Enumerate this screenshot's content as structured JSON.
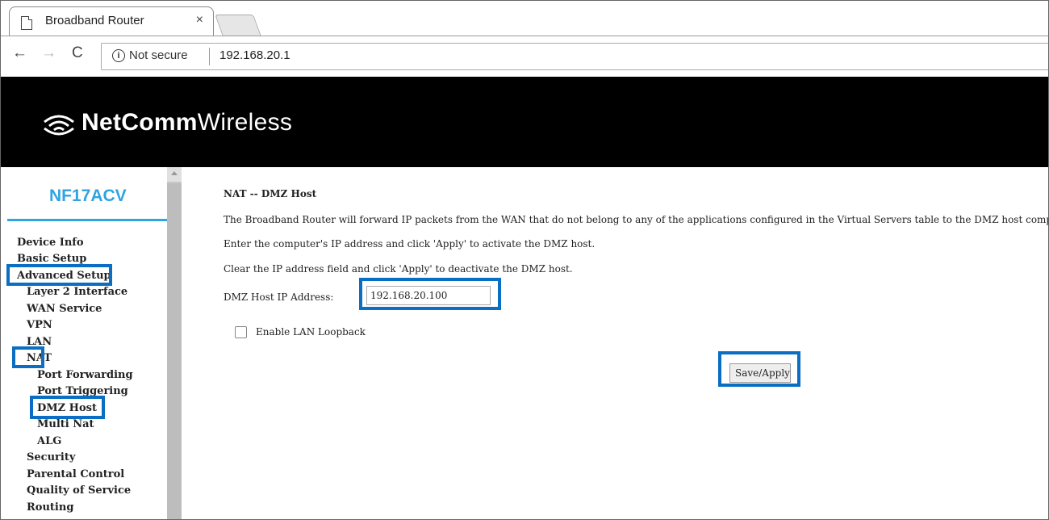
{
  "browser": {
    "tab_title": "Broadband Router",
    "tab_close": "×",
    "security_label": "Not secure",
    "url": "192.168.20.1",
    "info_glyph": "i",
    "back_glyph": "←",
    "forward_glyph": "→",
    "reload_glyph": "C"
  },
  "brand": {
    "logo_bold": "NetComm",
    "logo_light": "Wireless",
    "model": "NF17ACV"
  },
  "sidebar": {
    "items": [
      {
        "label": "Device Info"
      },
      {
        "label": "Basic Setup"
      },
      {
        "label": "Advanced Setup"
      },
      {
        "label": "Layer 2 Interface"
      },
      {
        "label": "WAN Service"
      },
      {
        "label": "VPN"
      },
      {
        "label": "LAN"
      },
      {
        "label": "NAT"
      },
      {
        "label": "Port Forwarding"
      },
      {
        "label": "Port Triggering"
      },
      {
        "label": "DMZ Host"
      },
      {
        "label": "Multi Nat"
      },
      {
        "label": "ALG"
      },
      {
        "label": "Security"
      },
      {
        "label": "Parental Control"
      },
      {
        "label": "Quality of Service"
      },
      {
        "label": "Routing"
      }
    ]
  },
  "main": {
    "title": "NAT -- DMZ Host",
    "para1": "The Broadband Router will forward IP packets from the WAN that do not belong to any of the applications configured in the Virtual Servers table to the DMZ host computer.",
    "para2": "Enter the computer's IP address and click 'Apply' to activate the DMZ host.",
    "para3": "Clear the IP address field and click 'Apply' to deactivate the DMZ host.",
    "ip_label": "DMZ Host IP Address:",
    "ip_value": "192.168.20.100",
    "loopback_label": "Enable LAN Loopback",
    "loopback_checked": false,
    "save_label": "Save/Apply"
  },
  "colors": {
    "accent": "#2fa4e0",
    "highlight": "#0a6fc2"
  }
}
